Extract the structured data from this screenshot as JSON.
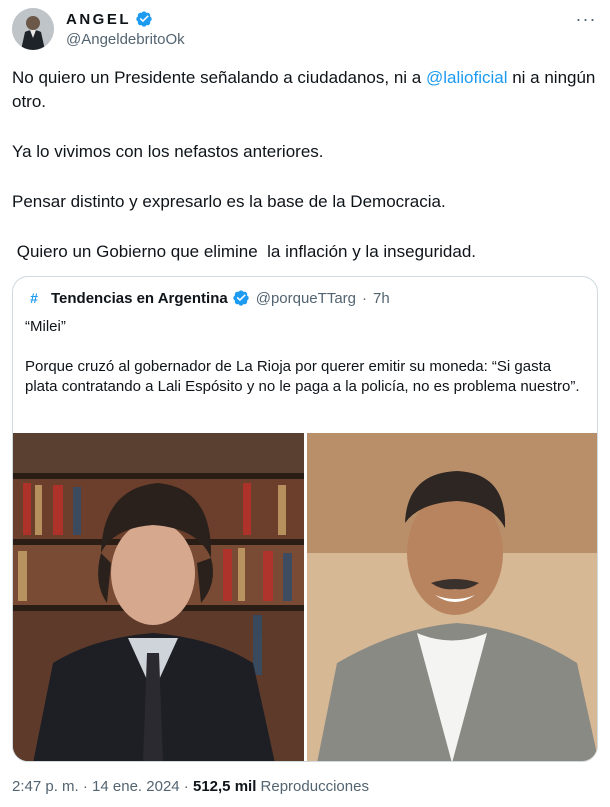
{
  "author": {
    "display_name": "ANGEL",
    "handle": "@AngeldebritoOk",
    "verified_icon": "verified-badge-icon",
    "more_icon": "more-options-icon"
  },
  "tweet": {
    "line1_before": "No quiero un Presidente señalando a ciudadanos, ni a ",
    "mention": "@lalioficial",
    "line1_after": " ni a ningún otro.",
    "para2": "Ya lo vivimos con los nefastos anteriores.",
    "para3": "Pensar distinto y expresarlo es la base de la Democracia.",
    "para4": " Quiero un Gobierno que elimine  la inflación y la inseguridad."
  },
  "quote": {
    "hash": "#",
    "name": "Tendencias en Argentina",
    "handle": "@porqueTTarg",
    "separator": "·",
    "time": "7h",
    "title": "“Milei”",
    "body": "Porque cruzó al gobernador de La Rioja por querer emitir su moneda: “Si gasta plata contratando a Lali Espósito y no le paga a la policía, no es problema nuestro”."
  },
  "meta": {
    "time": "2:47 p. m.",
    "sep1": " · ",
    "date": "14 ene. 2024",
    "sep2": " · ",
    "views": "512,5 mil",
    "views_label": " Reproducciones"
  },
  "colors": {
    "accent": "#1d9bf0",
    "text": "#0f1419",
    "secondary": "#536471",
    "border": "#cfd9de"
  }
}
